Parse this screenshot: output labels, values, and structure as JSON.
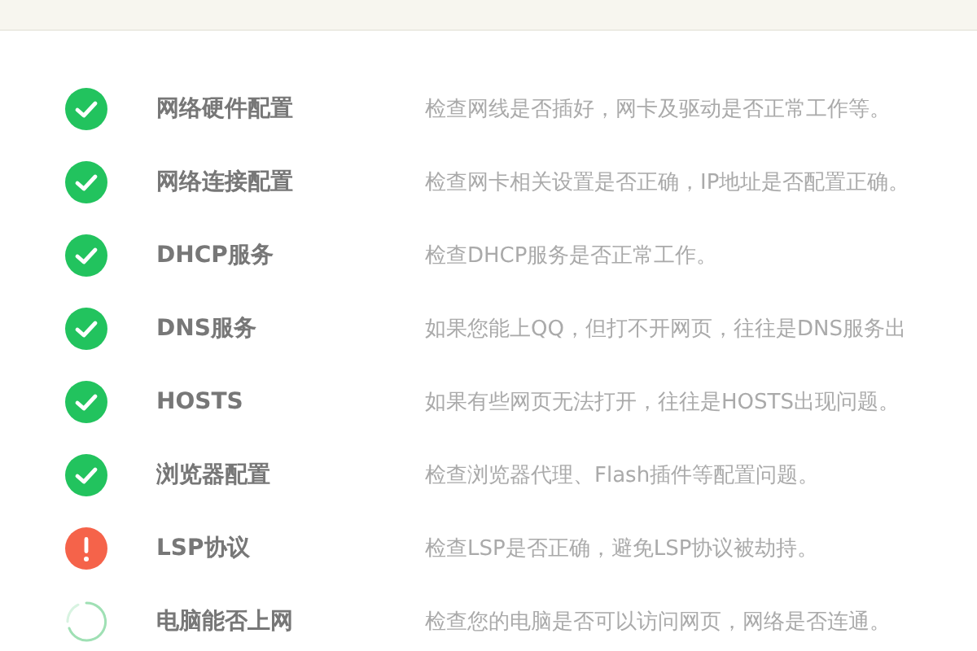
{
  "checks": [
    {
      "kind": "passed",
      "name": "网络硬件配置",
      "description": "检查网线是否插好，网卡及驱动是否正常工作等。"
    },
    {
      "kind": "passed",
      "name": "网络连接配置",
      "description": "检查网卡相关设置是否正确，IP地址是否配置正确。"
    },
    {
      "kind": "passed",
      "name": "DHCP服务",
      "description": "检查DHCP服务是否正常工作。"
    },
    {
      "kind": "passed",
      "name": "DNS服务",
      "description": "如果您能上QQ，但打不开网页，往往是DNS服务出"
    },
    {
      "kind": "passed",
      "name": "HOSTS",
      "description": "如果有些网页无法打开，往往是HOSTS出现问题。"
    },
    {
      "kind": "passed",
      "name": "浏览器配置",
      "description": "检查浏览器代理、Flash插件等配置问题。"
    },
    {
      "kind": "warning",
      "name": "LSP协议",
      "description": "检查LSP是否正确，避免LSP协议被劫持。"
    },
    {
      "kind": "loading",
      "name": "电脑能否上网",
      "description": "检查您的电脑是否可以访问网页，网络是否连通。"
    }
  ]
}
